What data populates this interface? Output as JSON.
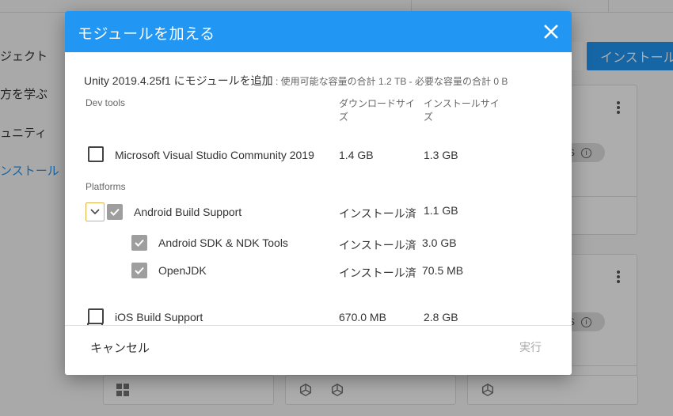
{
  "background": {
    "sidebar": [
      "ジェクト",
      "方を学ぶ",
      "ュニティ",
      "ンストール"
    ],
    "install_button": "インストール",
    "chip_text": "S"
  },
  "dialog": {
    "title": "モジュールを加える",
    "summary_main": "Unity 2019.4.25f1 にモジュールを追加",
    "summary_sub": " : 使用可能な容量の合計 1.2 TB - 必要な容量の合計 0 B",
    "col_download": "ダウンロードサイズ",
    "col_install": "インストールサイズ",
    "sections": {
      "dev_tools": "Dev tools",
      "platforms": "Platforms"
    },
    "modules": [
      {
        "name": "Microsoft Visual Studio Community 2019",
        "download": "1.4 GB",
        "install": "1.3 GB",
        "checked": false
      },
      {
        "name": "Android Build Support",
        "download": "インストール済",
        "install": "1.1 GB",
        "checked": true
      },
      {
        "name": "Android SDK & NDK Tools",
        "download": "インストール済",
        "install": "3.0 GB",
        "checked": true
      },
      {
        "name": "OpenJDK",
        "download": "インストール済",
        "install": "70.5 MB",
        "checked": true
      },
      {
        "name": "iOS Build Support",
        "download": "670.0 MB",
        "install": "2.8 GB",
        "checked": false
      }
    ],
    "footer": {
      "cancel": "キャンセル",
      "run": "実行"
    }
  },
  "colors": {
    "accent": "#2196f3",
    "checked": "#9e9e9e",
    "expand_border": "#e0b34a"
  }
}
